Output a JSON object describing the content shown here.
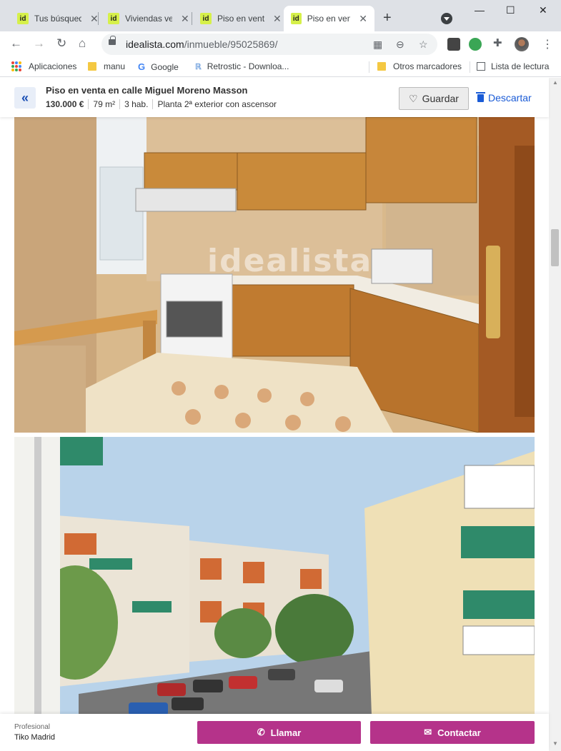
{
  "browser": {
    "tabs": [
      {
        "title": "Tus búsqued"
      },
      {
        "title": "Viviendas ve"
      },
      {
        "title": "Piso en vent"
      },
      {
        "title": "Piso en vent"
      }
    ],
    "favicon_text": "id",
    "url_host": "idealista.com",
    "url_path": "/inmueble/95025869/",
    "bookmarks": {
      "apps": "Aplicaciones",
      "manu": "manu",
      "google": "Google",
      "retrostic": "Retrostic - Downloa...",
      "otros": "Otros marcadores",
      "lectura": "Lista de lectura"
    }
  },
  "listing": {
    "title": "Piso en venta en calle Miguel Moreno Masson",
    "price": "130.000 €",
    "area": "79 m²",
    "rooms": "3 hab.",
    "floor": "Planta 2ª exterior con ascensor",
    "save_label": "Guardar",
    "discard_label": "Descartar",
    "watermark": "idealista"
  },
  "contact": {
    "pro_label": "Profesional",
    "agency": "Tiko Madrid",
    "call_label": "Llamar",
    "contact_label": "Contactar"
  },
  "colors": {
    "accent": "#b5338a",
    "link": "#1a5bd6"
  }
}
